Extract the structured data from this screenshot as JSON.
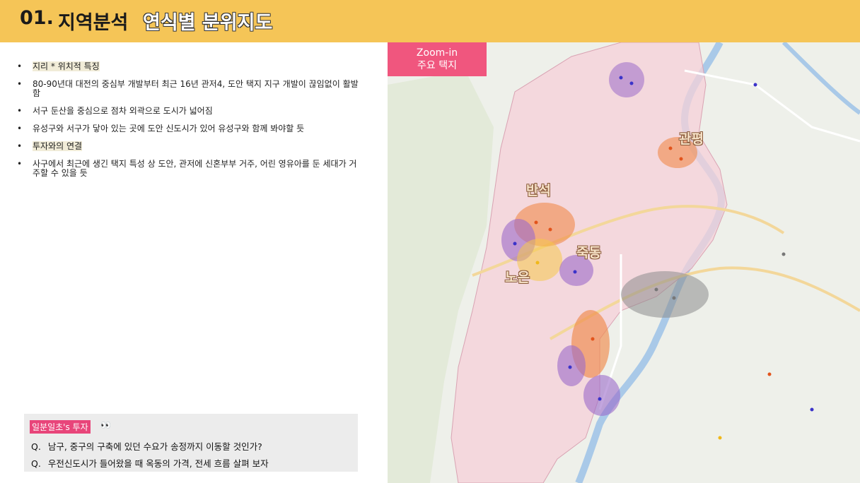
{
  "header": {
    "number": "01.",
    "title": "지역분석",
    "subtitle": "연식별 분위지도"
  },
  "bullets": [
    {
      "text": "지리 * 위치적 특징",
      "highlight": true
    },
    {
      "text": "80-90년대 대전의 중심부 개발부터 최근 16년 관저4, 도안 택지 지구 개발이 끊임없이 활발함",
      "highlight": false
    },
    {
      "text": "서구 둔산을 중심으로 점차 외곽으로 도시가 넓어짐",
      "highlight": false
    },
    {
      "text": "유성구와 서구가 닿아 있는 곳에 도안 신도시가 있어 유성구와 함께 봐야할 듯",
      "highlight": false
    },
    {
      "text": "투자와의 연결",
      "highlight": true
    },
    {
      "text": "사구에서 최근에 생긴 택지 특성 상 도안, 관저에 신혼부부 거주, 어린 영유아를 둔 세대가 거주할 수 있을 듯",
      "highlight": false
    }
  ],
  "bullet_symbol": "•",
  "invest": {
    "tag": "일분일초's 투자",
    "eyes": "👀",
    "q_prefix": "Q.",
    "questions": [
      "남구, 중구의 구축에 있던 수요가 송정까지 이동할 것인가?",
      "우전신도시가 들어왔을 때 옥동의 가격, 전세 흐름 살펴 보자"
    ]
  },
  "map": {
    "zoom_line1": "Zoom-in",
    "zoom_line2": "주요 택지",
    "labels": {
      "gwanpyeong": "관평",
      "banseok": "반석",
      "jukdong": "죽동",
      "noeun": "노은"
    }
  },
  "colors": {
    "header": "#f5c557",
    "accent_pink": "#f0567e",
    "purple": "#9b6bc9",
    "orange": "#f08a4b",
    "yellow": "#f5c84a",
    "gray": "#8d8d8d"
  }
}
